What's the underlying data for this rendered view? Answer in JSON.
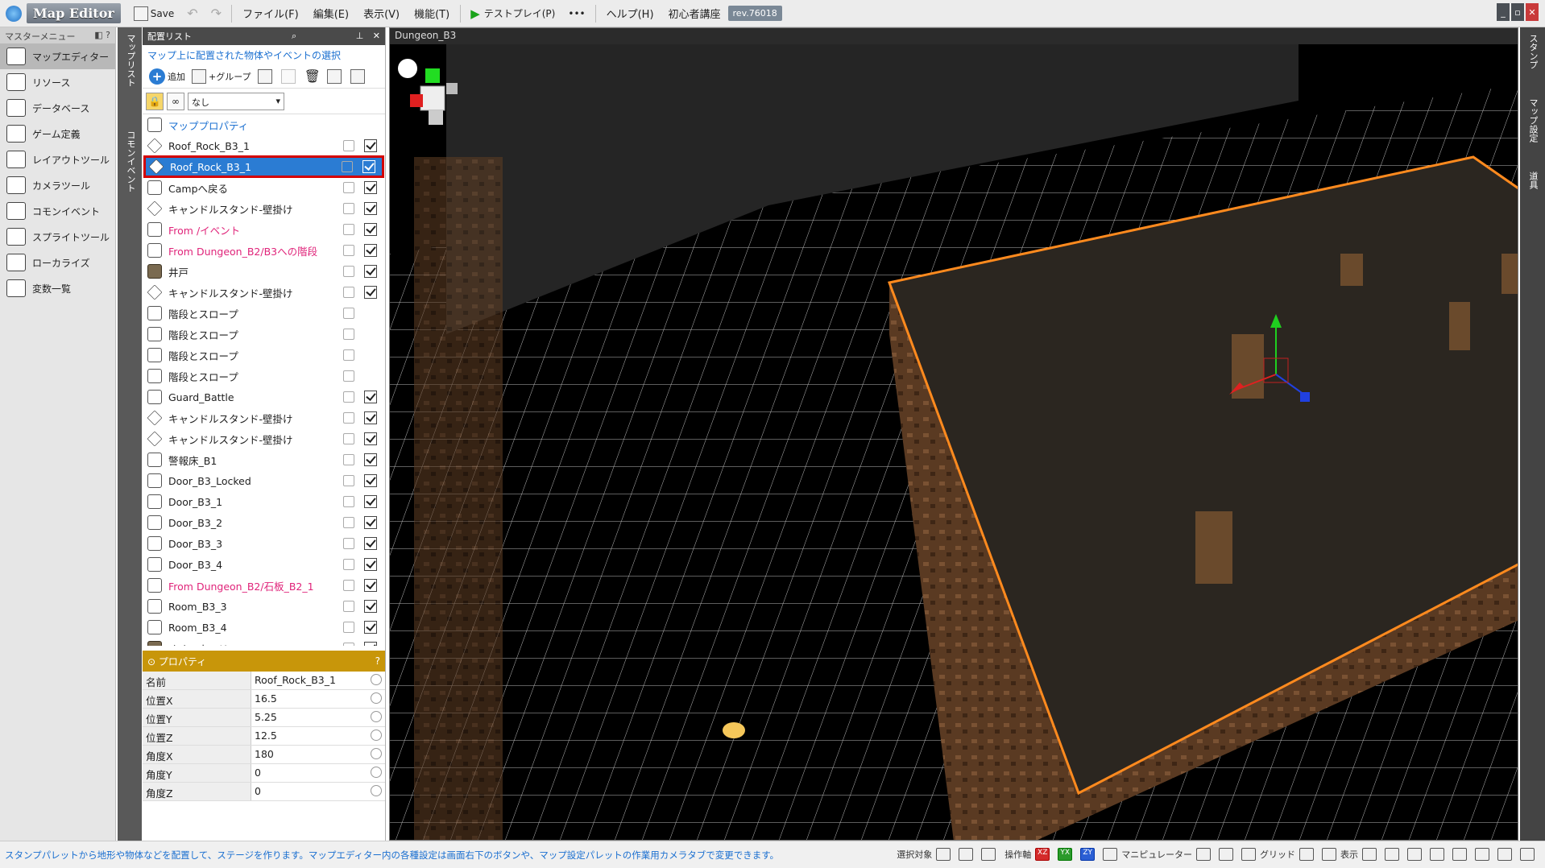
{
  "titlebar": {
    "app_title": "Map Editor",
    "save_label": "Save",
    "menus": [
      "ファイル(F)",
      "編集(E)",
      "表示(V)",
      "機能(T)"
    ],
    "testplay_label": "テストプレイ(P)",
    "more_label": "•••",
    "help_label": "ヘルプ(H)",
    "beginner_label": "初心者講座",
    "rev_label": "rev.76018"
  },
  "master_menu": {
    "title": "マスターメニュー",
    "items": [
      {
        "label": "マップエディター",
        "icon": "map-editor-icon",
        "active": true
      },
      {
        "label": "リソース",
        "icon": "resource-icon",
        "active": false
      },
      {
        "label": "データベース",
        "icon": "database-icon",
        "active": false
      },
      {
        "label": "ゲーム定義",
        "icon": "game-definition-icon",
        "active": false
      },
      {
        "label": "レイアウトツール",
        "icon": "layout-tool-icon",
        "active": false
      },
      {
        "label": "カメラツール",
        "icon": "camera-tool-icon",
        "active": false
      },
      {
        "label": "コモンイベント",
        "icon": "common-event-icon",
        "active": false
      },
      {
        "label": "スプライトツール",
        "icon": "sprite-tool-icon",
        "active": false
      },
      {
        "label": "ローカライズ",
        "icon": "localize-icon",
        "active": false
      },
      {
        "label": "変数一覧",
        "icon": "variables-icon",
        "active": false
      }
    ]
  },
  "vertical_tabs": [
    "マップリスト",
    "コモンイベント"
  ],
  "placement": {
    "title": "配置リスト",
    "subtitle": "マップ上に配置された物体やイベントの選択",
    "add_label": "追加",
    "group_label": "+グループ",
    "filter_value": "なし",
    "items": [
      {
        "name": "マッププロパティ",
        "icon": "map-property-icon",
        "style": "blue",
        "check": false,
        "lock": false
      },
      {
        "name": "Roof_Rock_B3_1",
        "icon": "object-icon",
        "style": "",
        "check": true,
        "lock": true
      },
      {
        "name": "Roof_Rock_B3_1",
        "icon": "object-icon",
        "style": "",
        "check": true,
        "lock": true,
        "selected": true
      },
      {
        "name": "Campへ戻る",
        "icon": "event-icon",
        "style": "",
        "check": true,
        "lock": true
      },
      {
        "name": "キャンドルスタンド-壁掛け",
        "icon": "object-icon",
        "style": "",
        "check": true,
        "lock": true
      },
      {
        "name": "From /イベント",
        "icon": "event-page-icon",
        "style": "pink",
        "check": true,
        "lock": true
      },
      {
        "name": "From Dungeon_B2/B3への階段",
        "icon": "event-page-icon",
        "style": "pink",
        "check": true,
        "lock": true
      },
      {
        "name": "井戸",
        "icon": "image-icon",
        "style": "",
        "check": true,
        "lock": true
      },
      {
        "name": "キャンドルスタンド-壁掛け",
        "icon": "object-icon",
        "style": "",
        "check": true,
        "lock": true
      },
      {
        "name": "階段とスロープ",
        "icon": "stairs-icon",
        "style": "",
        "check": false,
        "lock": true
      },
      {
        "name": "階段とスロープ",
        "icon": "stairs-icon",
        "style": "",
        "check": false,
        "lock": true
      },
      {
        "name": "階段とスロープ",
        "icon": "stairs-icon",
        "style": "",
        "check": false,
        "lock": true
      },
      {
        "name": "階段とスロープ",
        "icon": "stairs-icon",
        "style": "",
        "check": false,
        "lock": true
      },
      {
        "name": "Guard_Battle",
        "icon": "event-icon",
        "style": "",
        "check": true,
        "lock": true
      },
      {
        "name": "キャンドルスタンド-壁掛け",
        "icon": "object-icon",
        "style": "",
        "check": true,
        "lock": true
      },
      {
        "name": "キャンドルスタンド-壁掛け",
        "icon": "object-icon",
        "style": "",
        "check": true,
        "lock": true
      },
      {
        "name": "警報床_B1",
        "icon": "event-icon",
        "style": "",
        "check": true,
        "lock": true
      },
      {
        "name": "Door_B3_Locked",
        "icon": "door-icon",
        "style": "",
        "check": true,
        "lock": true
      },
      {
        "name": "Door_B3_1",
        "icon": "door-icon",
        "style": "",
        "check": true,
        "lock": true
      },
      {
        "name": "Door_B3_2",
        "icon": "door-icon",
        "style": "",
        "check": true,
        "lock": true
      },
      {
        "name": "Door_B3_3",
        "icon": "door-icon",
        "style": "",
        "check": true,
        "lock": true
      },
      {
        "name": "Door_B3_4",
        "icon": "door-icon",
        "style": "",
        "check": true,
        "lock": true
      },
      {
        "name": "From Dungeon_B2/石板_B2_1",
        "icon": "event-page-icon",
        "style": "pink",
        "check": true,
        "lock": true
      },
      {
        "name": "Room_B3_3",
        "icon": "door-icon",
        "style": "",
        "check": true,
        "lock": true
      },
      {
        "name": "Room_B3_4",
        "icon": "door-icon",
        "style": "",
        "check": true,
        "lock": true
      },
      {
        "name": "オオコウモリ",
        "icon": "image-icon",
        "style": "",
        "check": true,
        "lock": true
      }
    ]
  },
  "properties": {
    "title": "プロパティ",
    "help": "?",
    "rows": [
      {
        "key": "名前",
        "value": "Roof_Rock_B3_1"
      },
      {
        "key": "位置X",
        "value": "16.5"
      },
      {
        "key": "位置Y",
        "value": "5.25"
      },
      {
        "key": "位置Z",
        "value": "12.5"
      },
      {
        "key": "角度X",
        "value": "180"
      },
      {
        "key": "角度Y",
        "value": "0"
      },
      {
        "key": "角度Z",
        "value": "0"
      }
    ]
  },
  "viewport": {
    "title": "Dungeon_B3"
  },
  "right_tabs": [
    "スタンプ",
    "マップ設定",
    "道具"
  ],
  "statusbar": {
    "message": "スタンプパレットから地形や物体などを配置して、ステージを作ります。マップエディター内の各種設定は画面右下のボタンや、マップ設定パレットの作業用カメラタブで変更できます。",
    "select_label": "選択対象",
    "axis_label": "操作軸",
    "xz": "XZ",
    "yx": "YX",
    "zy": "ZY",
    "manipulator_label": "マニピュレーター",
    "grid_label": "グリッド",
    "display_label": "表示"
  }
}
